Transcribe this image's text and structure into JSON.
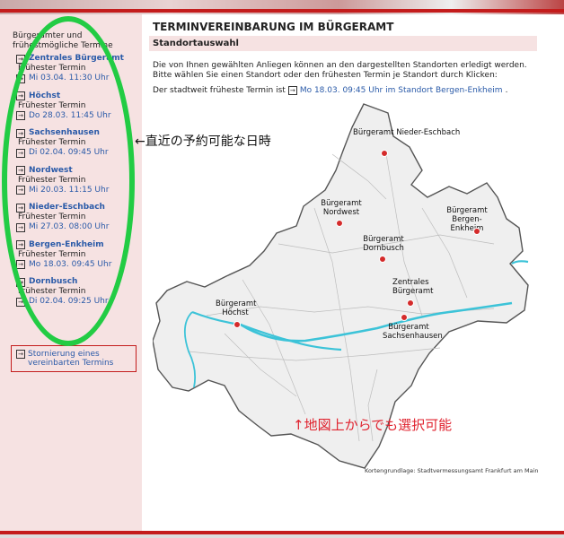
{
  "page": {
    "title": "TERMINVEREINBARUNG IM BÜRGERAMT",
    "section": "Standortauswahl",
    "intro": "Die von Ihnen gewählten Anliegen können an den dargestellten Standorten erledigt werden. Bitte wählen Sie einen Standort oder den frühesten Termin je Standort durch Klicken:",
    "earliest_prefix": "Der stadtweit früheste Termin ist",
    "earliest_link": "Mo 18.03. 09:45 Uhr im Standort Bergen-Enkheim",
    "earliest_suffix": "."
  },
  "sidebar": {
    "heading": "Bürgerämter und frühestmögliche Termine",
    "label": "Frühester Termin",
    "locations": [
      {
        "name": "Zentrales Bürgeramt",
        "date": "Mi 03.04. 11:30 Uhr"
      },
      {
        "name": "Höchst",
        "date": "Do 28.03. 11:45 Uhr"
      },
      {
        "name": "Sachsenhausen",
        "date": "Di 02.04. 09:45 Uhr"
      },
      {
        "name": "Nordwest",
        "date": "Mi 20.03. 11:15 Uhr"
      },
      {
        "name": "Nieder-Eschbach",
        "date": "Mi 27.03. 08:00 Uhr"
      },
      {
        "name": "Bergen-Enkheim",
        "date": "Mo 18.03. 09:45 Uhr"
      },
      {
        "name": "Dornbusch",
        "date": "Di 02.04. 09:25 Uhr"
      }
    ],
    "cancel_link": "Stornierung eines vereinbarten Termins"
  },
  "map": {
    "labels": {
      "nieder_eschbach": "Bürgeramt Nieder-Eschbach",
      "nordwest": "Bürgeramt Nordwest",
      "bergen_enkheim": "Bürgeramt Bergen-Enkheim",
      "dornbusch": "Bürgeramt Dornbusch",
      "zentral": "Zentrales Bürgeramt",
      "hoechst": "Bürgeramt Höchst",
      "sachsenhausen": "Bürgeramt Sachsenhausen"
    },
    "credit": "Kortengrundlage: Stadtvermessungsamt Frankfurt am Main"
  },
  "annotations": {
    "left": "←直近の予約可能な日時",
    "map": "↑地図上からでも選択可能"
  },
  "colors": {
    "accent_red": "#c41c1c",
    "link_blue": "#2a5aa8",
    "sidebar_bg": "#f6e2e2",
    "highlight_green": "#22cc44",
    "river": "#3cc3d8",
    "pin": "#d42b2b"
  }
}
